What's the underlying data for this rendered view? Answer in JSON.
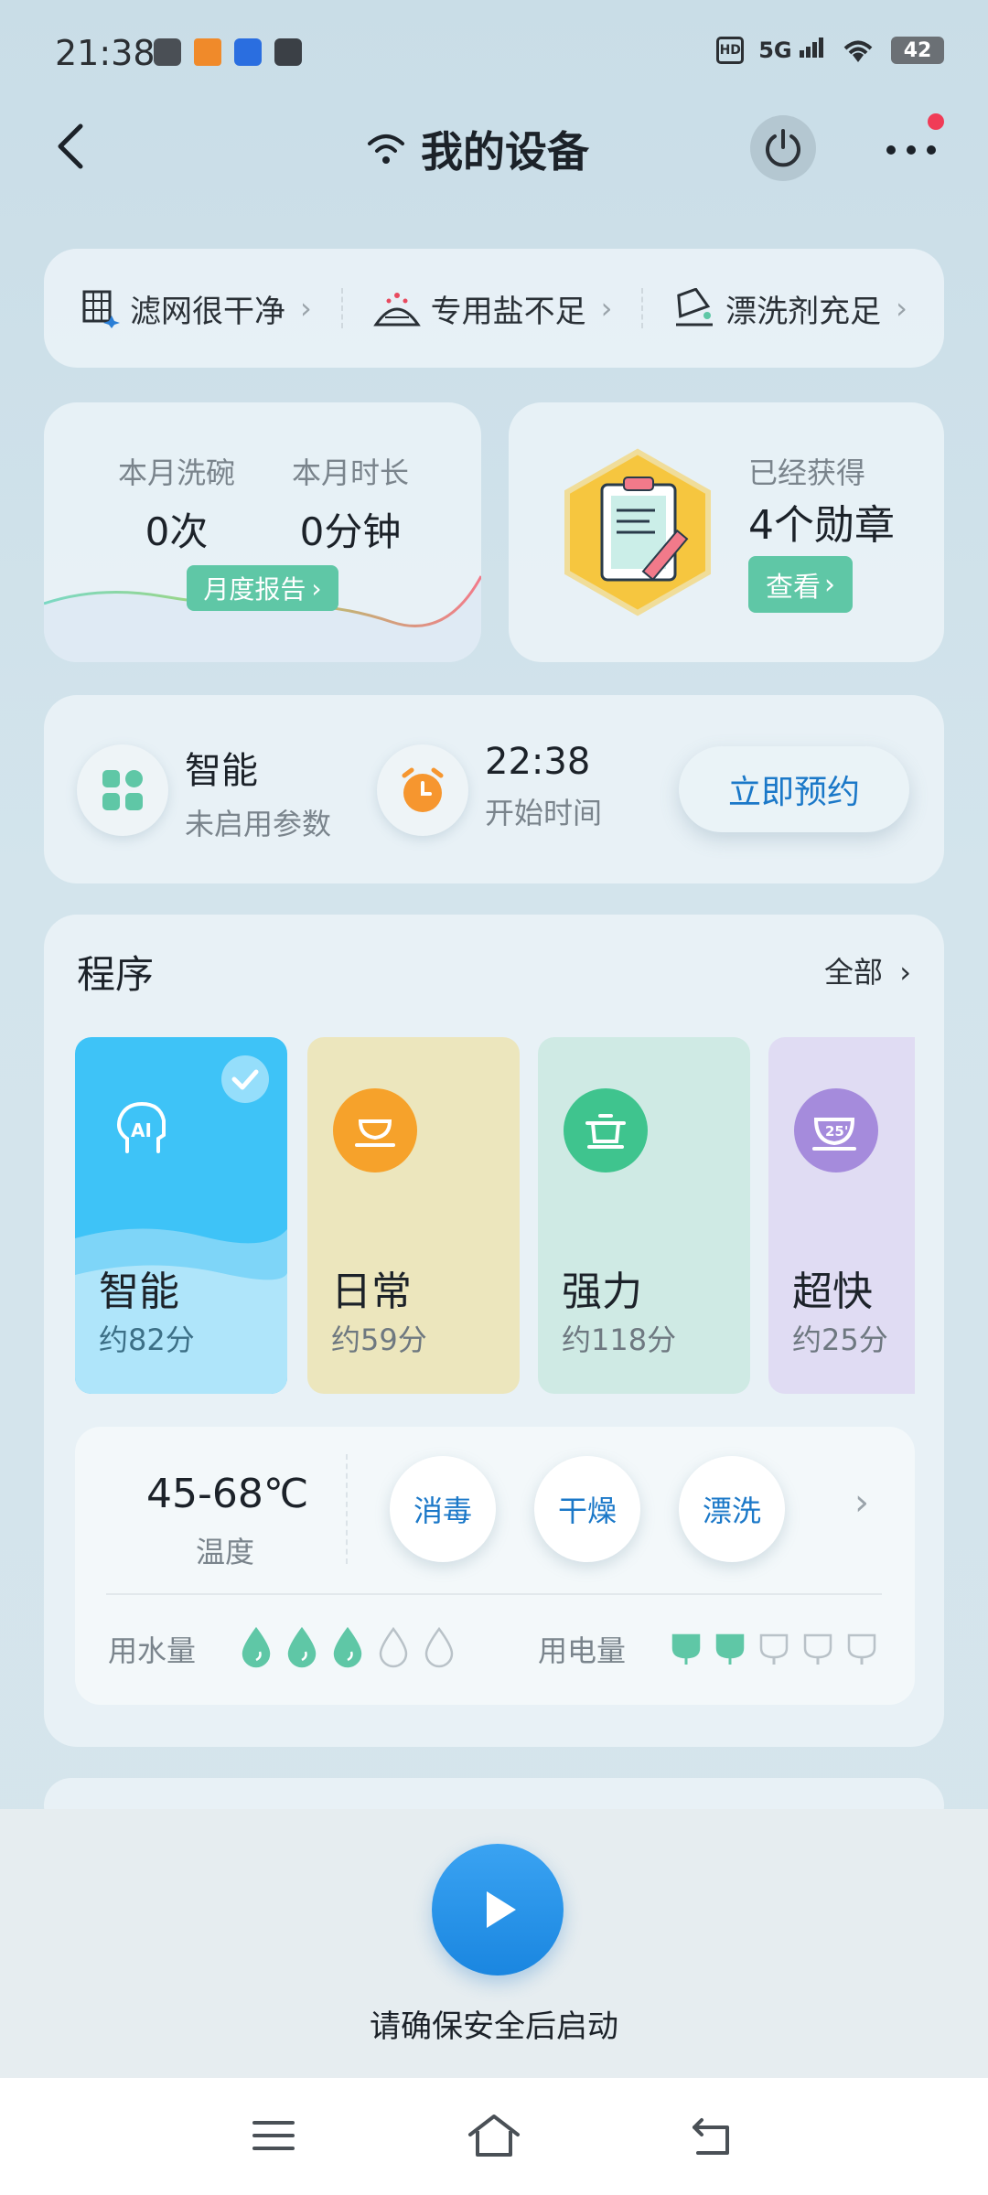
{
  "status_bar": {
    "time": "21:38",
    "right_icons": [
      "hd-icon",
      "5g-signal-icon",
      "wifi-icon"
    ],
    "network": "5G",
    "battery": "42"
  },
  "header": {
    "title": "我的设备",
    "icons": [
      "back-arrow-icon",
      "wifi-icon",
      "power-icon",
      "more-icon"
    ],
    "more_has_notification": true
  },
  "status_strip": [
    {
      "label": "滤网很干净",
      "icon": "filter-icon"
    },
    {
      "label": "专用盐不足",
      "icon": "salt-icon"
    },
    {
      "label": "漂洗剂充足",
      "icon": "rinse-aid-icon"
    }
  ],
  "stats": {
    "wash_label": "本月洗碗",
    "wash_value": "0次",
    "duration_label": "本月时长",
    "duration_value": "0分钟",
    "report_button": "月度报告"
  },
  "badges": {
    "label": "已经获得",
    "count": "4个勋章",
    "view_button": "查看"
  },
  "schedule": {
    "mode_title": "智能",
    "mode_sub": "未启用参数",
    "time_title": "22:38",
    "time_sub": "开始时间",
    "book_button": "立即预约"
  },
  "programs": {
    "title": "程序",
    "all_link": "全部",
    "items": [
      {
        "name": "智能",
        "time": "约82分",
        "icon": "ai-head-icon",
        "selected": true,
        "color": "#3ec3f7"
      },
      {
        "name": "日常",
        "time": "约59分",
        "icon": "plate-icon",
        "selected": false,
        "color": "#ece6bd"
      },
      {
        "name": "强力",
        "time": "约118分",
        "icon": "pot-icon",
        "selected": false,
        "color": "#cfeae4"
      },
      {
        "name": "超快",
        "time": "约25分",
        "icon": "cup-25-icon",
        "selected": false,
        "color": "#e0dcf3"
      }
    ]
  },
  "options": {
    "temp_value": "45-68℃",
    "temp_label": "温度",
    "buttons": [
      "消毒",
      "干燥",
      "漂洗"
    ],
    "water_label": "用水量",
    "water_level": 3,
    "water_max": 5,
    "power_label": "用电量",
    "power_level": 2,
    "power_max": 5
  },
  "bottom": {
    "start_hint": "请确保安全后启动"
  },
  "colors": {
    "accent_green": "#5fc7a6",
    "accent_blue": "#1b78c8",
    "start_blue": "#2a95e8",
    "notify_red": "#f03c57"
  }
}
